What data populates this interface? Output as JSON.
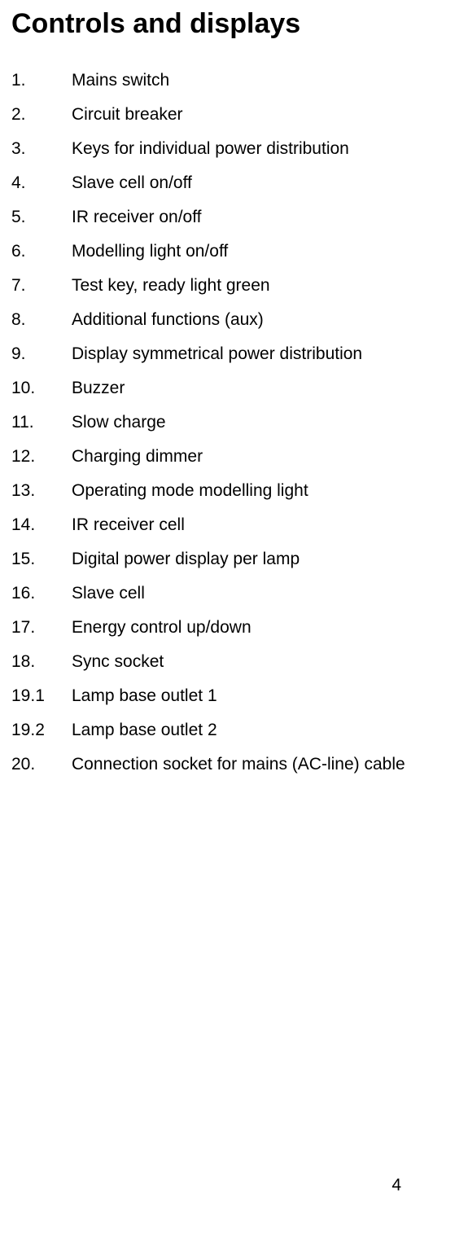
{
  "title": "Controls and displays",
  "items": [
    {
      "num": "1.",
      "label": "Mains switch"
    },
    {
      "num": "2.",
      "label": "Circuit breaker"
    },
    {
      "num": "3.",
      "label": "Keys for individual power distribution"
    },
    {
      "num": "4.",
      "label": "Slave cell on/off"
    },
    {
      "num": "5.",
      "label": "IR receiver on/off"
    },
    {
      "num": "6.",
      "label": "Modelling light on/off"
    },
    {
      "num": "7.",
      "label": "Test key, ready light green"
    },
    {
      "num": "8.",
      "label": "Additional functions (aux)"
    },
    {
      "num": "9.",
      "label": "Display symmetrical power distribution"
    },
    {
      "num": "10.",
      "label": "Buzzer"
    },
    {
      "num": "11.",
      "label": "Slow charge"
    },
    {
      "num": "12.",
      "label": "Charging dimmer"
    },
    {
      "num": "13.",
      "label": "Operating mode modelling light"
    },
    {
      "num": "14.",
      "label": "IR receiver cell"
    },
    {
      "num": "15.",
      "label": "Digital power display per lamp"
    },
    {
      "num": "16.",
      "label": "Slave cell"
    },
    {
      "num": "17.",
      "label": "Energy control up/down"
    },
    {
      "num": "18.",
      "label": "Sync socket"
    },
    {
      "num": "19.1",
      "label": "Lamp base outlet 1"
    },
    {
      "num": "19.2",
      "label": "Lamp base outlet 2"
    },
    {
      "num": "20.",
      "label": "Connection socket for mains (AC-line) cable"
    }
  ],
  "page_number": "4"
}
